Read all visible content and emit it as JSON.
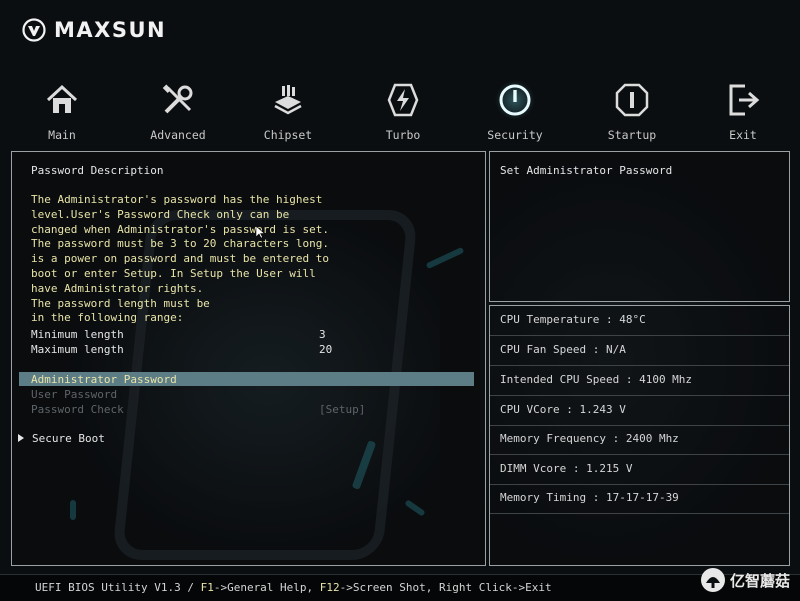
{
  "brand": {
    "name": "MAXSUN"
  },
  "tabs": [
    {
      "label": "Main",
      "icon": "home-icon"
    },
    {
      "label": "Advanced",
      "icon": "tools-icon"
    },
    {
      "label": "Chipset",
      "icon": "chip-icon"
    },
    {
      "label": "Turbo",
      "icon": "lightning-icon"
    },
    {
      "label": "Security",
      "icon": "power-icon",
      "active": true
    },
    {
      "label": "Startup",
      "icon": "startup-icon"
    },
    {
      "label": "Exit",
      "icon": "exit-icon"
    }
  ],
  "left_panel": {
    "description_title": "Password Description",
    "description_lines": [
      "The Administrator's password has the highest",
      "level.User's Password Check only can be",
      "changed when Administrator's password is set.",
      "The password must be 3 to 20 characters long.",
      "is a power on password and must be entered to",
      "boot or enter Setup. In Setup the User will",
      "have Administrator rights.",
      "The password length must be",
      "in the following range:"
    ],
    "min_length_label": "Minimum length",
    "min_length_value": "3",
    "max_length_label": "Maximum length",
    "max_length_value": "20",
    "admin_password_label": "Administrator Password",
    "user_password_label": "User Password",
    "password_check_label": "Password Check",
    "password_check_value": "[Setup]",
    "secure_boot_label": "Secure Boot"
  },
  "help_panel": {
    "title": "Set Administrator Password"
  },
  "info_panel": {
    "rows": [
      "CPU Temperature : 48°C",
      "CPU Fan Speed : N/A",
      "Intended CPU Speed : 4100 Mhz",
      "CPU VCore : 1.243 V",
      "Memory Frequency : 2400 Mhz",
      "DIMM Vcore : 1.215 V",
      "Memory Timing : 17-17-17-39"
    ]
  },
  "footer": {
    "prefix": "UEFI BIOS Utility V1.3 / ",
    "f1_key": "F1",
    "f1_text": "->General Help, ",
    "f12_key": "F12",
    "f12_text": "->Screen Shot, Right Click->Exit",
    "watermark": "亿智蘑菇"
  },
  "colors": {
    "highlight": "#5c7c86",
    "text_yellow": "#e8e4a8",
    "accent_cyan": "#2e8e98"
  }
}
